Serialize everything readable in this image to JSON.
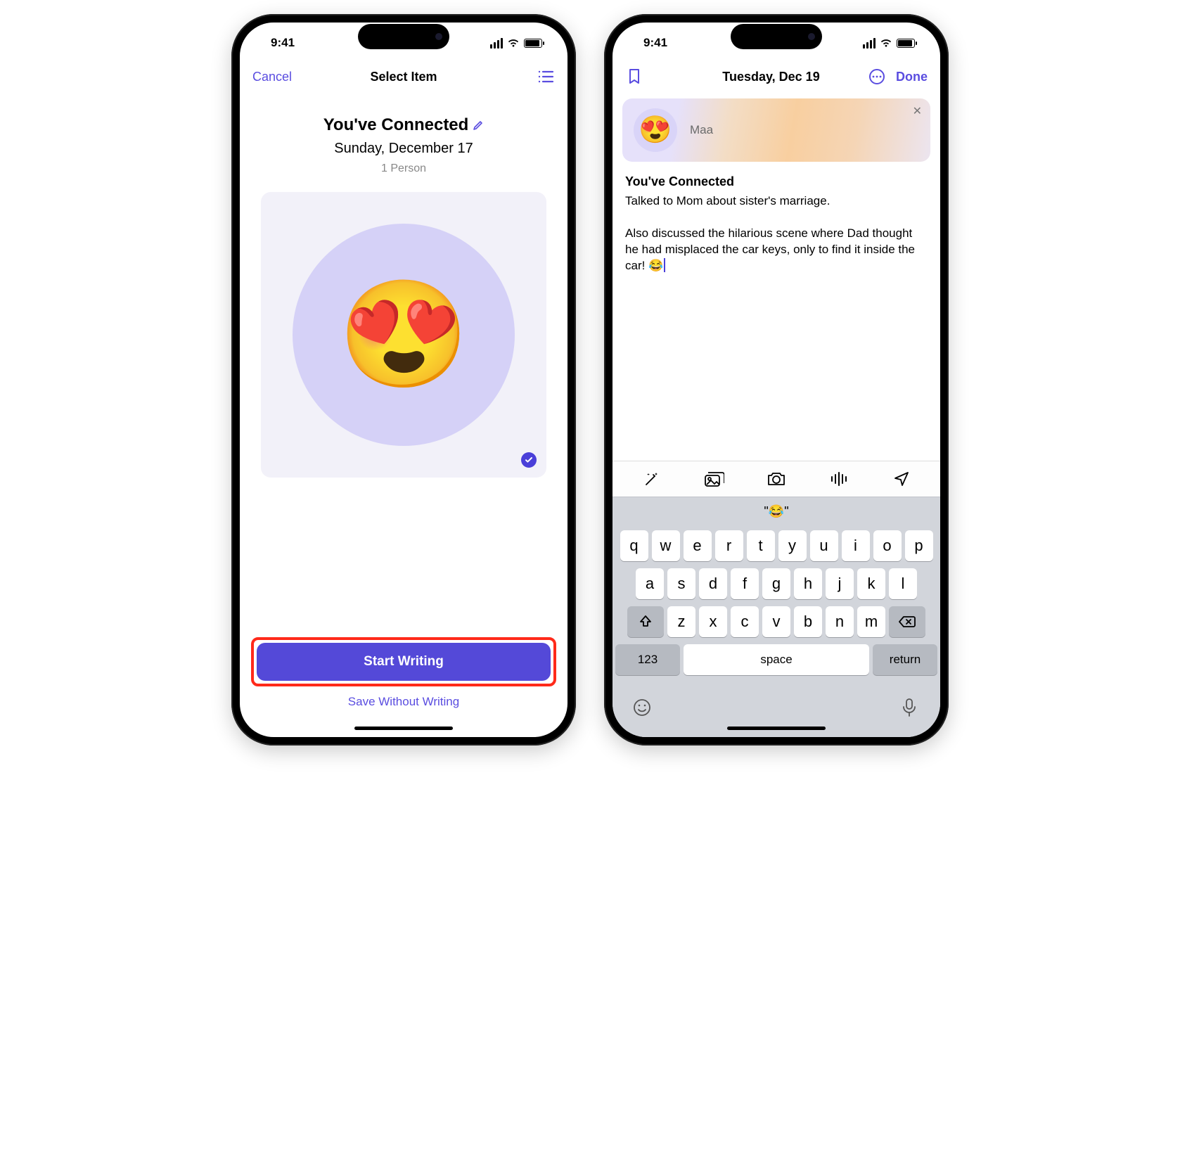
{
  "status": {
    "time": "9:41"
  },
  "left": {
    "nav": {
      "cancel": "Cancel",
      "title": "Select Item"
    },
    "hero": {
      "title": "You've Connected",
      "date": "Sunday, December 17",
      "subtitle": "1 Person",
      "emoji": "😍"
    },
    "actions": {
      "primary": "Start Writing",
      "secondary": "Save Without Writing"
    }
  },
  "right": {
    "nav": {
      "title": "Tuesday, Dec 19",
      "done": "Done"
    },
    "contact": {
      "emoji": "😍",
      "name": "Maa"
    },
    "entry": {
      "title": "You've Connected",
      "body": "Talked to Mom about sister's marriage.\n\nAlso discussed the hilarious scene where Dad thought he had misplaced the car keys, only to find it inside the car! 😂"
    },
    "suggestion": "\"😂\"",
    "keyboard": {
      "row1": [
        "q",
        "w",
        "e",
        "r",
        "t",
        "y",
        "u",
        "i",
        "o",
        "p"
      ],
      "row2": [
        "a",
        "s",
        "d",
        "f",
        "g",
        "h",
        "j",
        "k",
        "l"
      ],
      "row3": [
        "z",
        "x",
        "c",
        "v",
        "b",
        "n",
        "m"
      ],
      "numKey": "123",
      "space": "space",
      "return": "return"
    }
  }
}
